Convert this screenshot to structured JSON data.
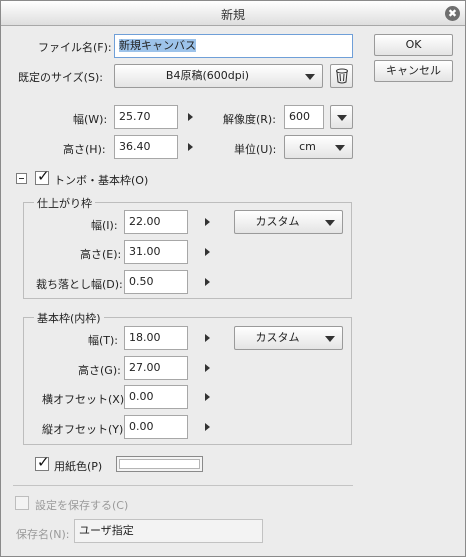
{
  "window": {
    "title": "新規",
    "close_glyph": "✖"
  },
  "buttons": {
    "ok": "OK",
    "cancel": "キャンセル"
  },
  "file": {
    "label": "ファイル名(F):",
    "value": "新規キャンバス"
  },
  "preset": {
    "label": "既定のサイズ(S):",
    "value": "B4原稿(600dpi)"
  },
  "canvas": {
    "width_label": "幅(W):",
    "width_value": "25.70",
    "height_label": "高さ(H):",
    "height_value": "36.40",
    "resolution_label": "解像度(R):",
    "resolution_value": "600",
    "unit_label": "単位(U):",
    "unit_value": "cm"
  },
  "tombo": {
    "label": "トンボ・基本枠(O)",
    "checked": true
  },
  "finish": {
    "title": "仕上がり枠",
    "width_label": "幅(I):",
    "width_value": "22.00",
    "height_label": "高さ(E):",
    "height_value": "31.00",
    "bleed_label": "裁ち落とし幅(D):",
    "bleed_value": "0.50",
    "preset_value": "カスタム"
  },
  "basic": {
    "title": "基本枠(内枠)",
    "width_label": "幅(T):",
    "width_value": "18.00",
    "height_label": "高さ(G):",
    "height_value": "27.00",
    "h_offset_label": "横オフセット(X):",
    "h_offset_value": "0.00",
    "v_offset_label": "縦オフセット(Y):",
    "v_offset_value": "0.00",
    "preset_value": "カスタム"
  },
  "paper": {
    "label": "用紙色(P)",
    "checked": true,
    "color": "#ffffff"
  },
  "save_settings": {
    "label": "設定を保存する(C)",
    "checked": false
  },
  "save_name": {
    "label": "保存名(N):",
    "value": "ユーザ指定"
  }
}
